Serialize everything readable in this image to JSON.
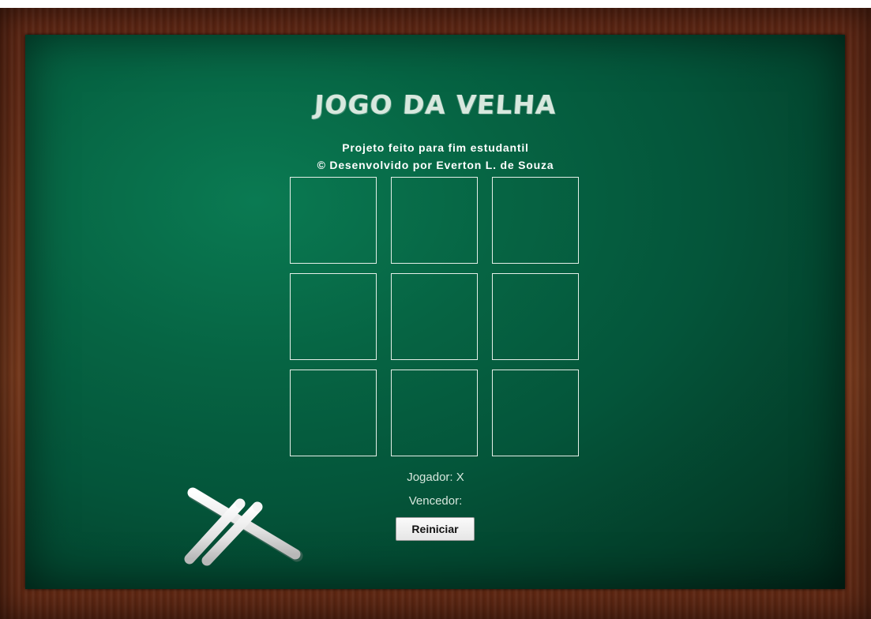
{
  "title": "JOGO DA VELHA",
  "subtitle_line1": "Projeto feito para fim estudantil",
  "subtitle_line2": "© Desenvolvido por Everton L. de Souza",
  "board": [
    "",
    "",
    "",
    "",
    "",
    "",
    "",
    "",
    ""
  ],
  "status": {
    "player_label": "Jogador: X",
    "winner_label": "Vencedor:"
  },
  "restart_label": "Reiniciar",
  "colors": {
    "chalkboard": "#066443",
    "frame": "#6e3118",
    "chalk_text": "#d8e8de"
  },
  "icons": [
    "chalk-sticks-icon"
  ]
}
